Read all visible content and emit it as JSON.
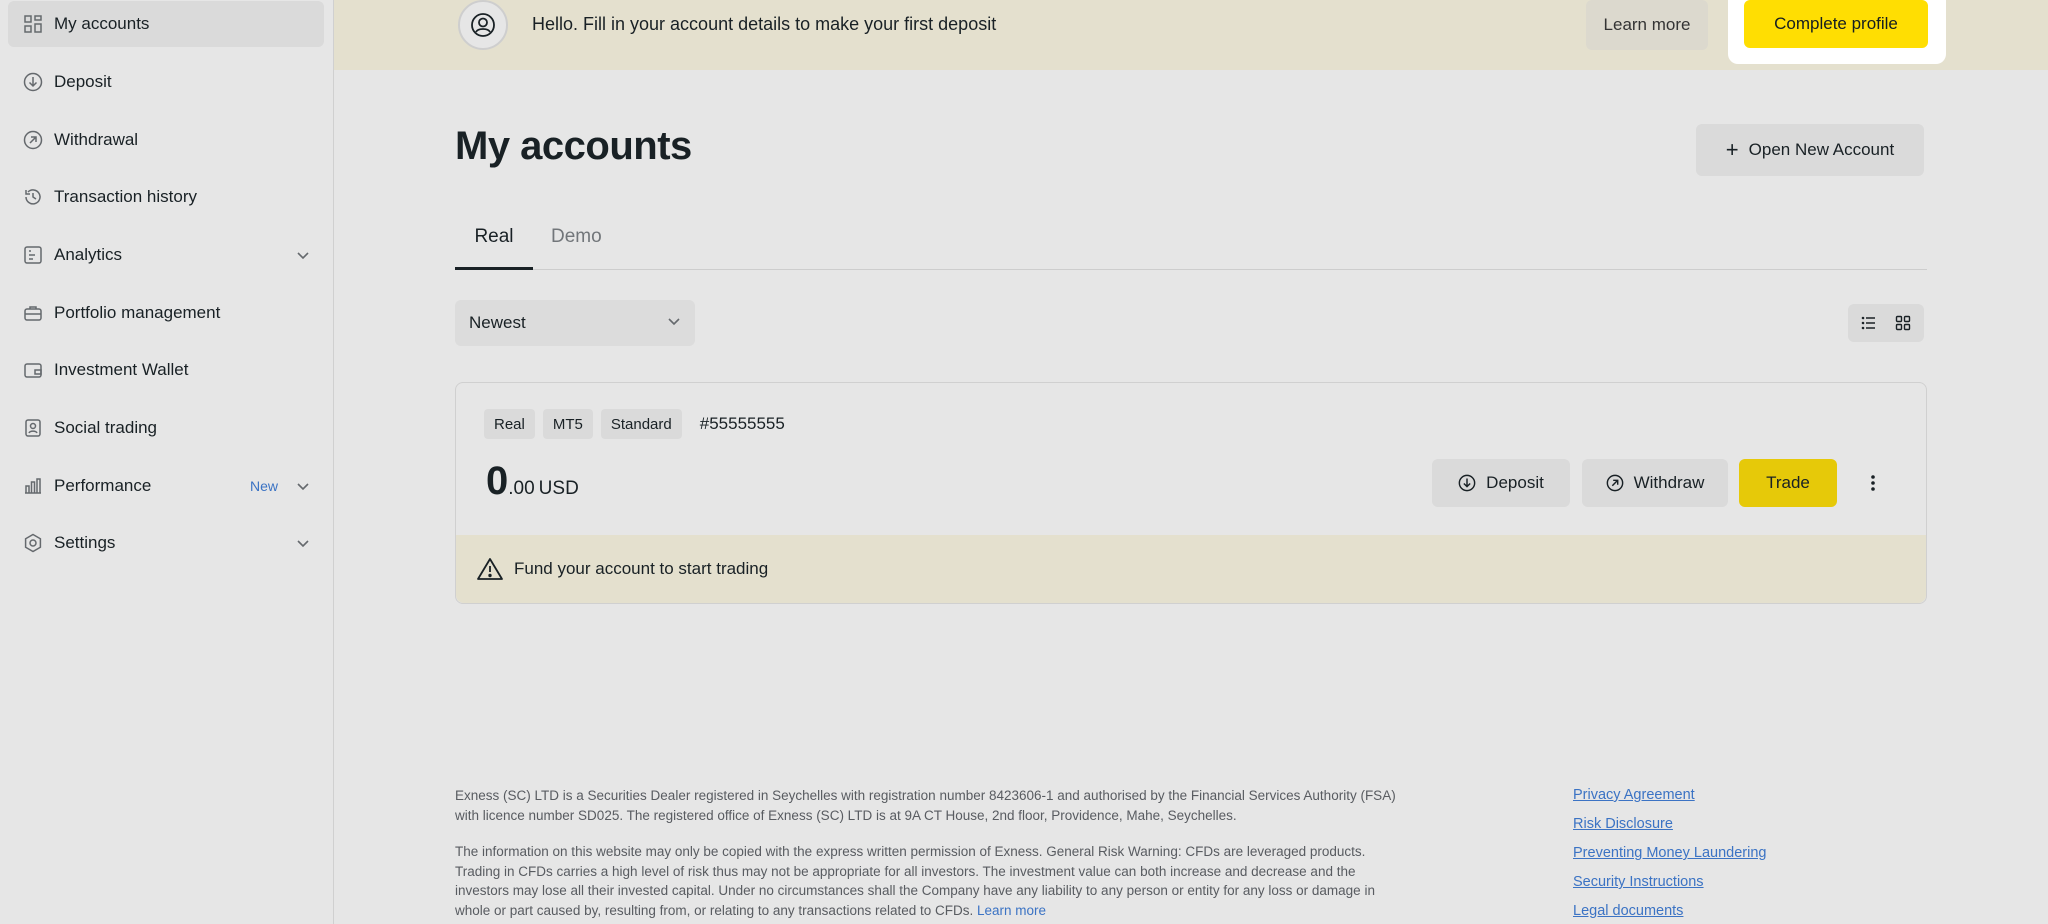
{
  "sidebar": {
    "items": [
      {
        "label": "My accounts",
        "icon": "grid-icon"
      },
      {
        "label": "Deposit",
        "icon": "arrow-down-circle-icon"
      },
      {
        "label": "Withdrawal",
        "icon": "arrow-up-right-circle-icon"
      },
      {
        "label": "Transaction history",
        "icon": "history-icon"
      },
      {
        "label": "Analytics",
        "icon": "analytics-icon"
      },
      {
        "label": "Portfolio management",
        "icon": "briefcase-icon"
      },
      {
        "label": "Investment Wallet",
        "icon": "wallet-icon"
      },
      {
        "label": "Social trading",
        "icon": "social-trading-icon"
      },
      {
        "label": "Performance",
        "icon": "bar-chart-icon",
        "badge": "New"
      },
      {
        "label": "Settings",
        "icon": "gear-icon"
      }
    ]
  },
  "banner": {
    "message": "Hello. Fill in your account details to make your first deposit",
    "learn_more": "Learn more",
    "complete_profile": "Complete profile"
  },
  "main": {
    "title": "My accounts",
    "open_account": "Open New Account",
    "tabs": [
      {
        "label": "Real"
      },
      {
        "label": "Demo"
      }
    ],
    "sort": {
      "selected": "Newest"
    }
  },
  "account": {
    "tags": [
      "Real",
      "MT5",
      "Standard"
    ],
    "number": "#55555555",
    "balance_int": "0",
    "balance_dec": ".00",
    "currency": "USD",
    "deposit": "Deposit",
    "withdraw": "Withdraw",
    "trade": "Trade",
    "fund_message": "Fund your account to start trading"
  },
  "footer": {
    "para1": "Exness (SC) LTD is a Securities Dealer registered in Seychelles with registration number 8423606-1 and authorised by the Financial Services Authority (FSA) with licence number SD025. The registered office of Exness (SC) LTD is at 9A CT House, 2nd floor, Providence, Mahe, Seychelles.",
    "para2": "The information on this website may only be copied with the express written permission of Exness. General Risk Warning: CFDs are leveraged products. Trading in CFDs carries a high level of risk thus may not be appropriate for all investors. The investment value can both increase and decrease and the investors may lose all their invested capital. Under no circumstances shall the Company have any liability to any person or entity for any loss or damage in whole or part caused by, resulting from, or relating to any transactions related to CFDs.",
    "learn_more": "Learn more",
    "links": [
      "Privacy Agreement",
      "Risk Disclosure",
      "Preventing Money Laundering",
      "Security Instructions",
      "Legal documents"
    ]
  },
  "colors": {
    "accent_yellow": "#ffde02",
    "link_blue": "#3b7bd8",
    "banner_bg": "#fdf9e4"
  }
}
